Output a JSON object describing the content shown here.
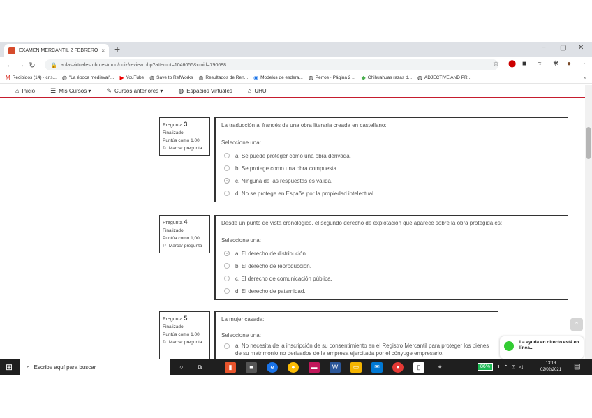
{
  "browser": {
    "tab_title": "EXAMEN MERCANTIL 2 FEBRERO",
    "tab_close": "×",
    "new_tab": "+",
    "window_controls": [
      "−",
      "▢",
      "✕"
    ],
    "url": "aulasvirtuales.uhu.es/mod/quiz/review.php?attempt=1046055&cmid=790688",
    "bookmarks": [
      {
        "icon": "gmail-icon",
        "label": "Recibidos (14) · cris..."
      },
      {
        "icon": "globe-icon",
        "label": "\"La época medieval\"..."
      },
      {
        "icon": "youtube-icon",
        "label": "YouTube"
      },
      {
        "icon": "globe-icon",
        "label": "Save to RefWorks"
      },
      {
        "icon": "globe-icon",
        "label": "Resultados de Ren..."
      },
      {
        "icon": "search-icon",
        "label": "Modelos de esdera..."
      },
      {
        "icon": "globe-icon",
        "label": "Perros · Página 2 ..."
      },
      {
        "icon": "game-icon",
        "label": "Chihuahuas razas d..."
      },
      {
        "icon": "globe-icon",
        "label": "ADJECTIVE AND PR..."
      }
    ],
    "bookmarks_more": "»"
  },
  "sitenav": {
    "items": [
      {
        "icon": "home-icon",
        "label": "Inicio"
      },
      {
        "icon": "courses-icon",
        "label": "Mis Cursos ▾"
      },
      {
        "icon": "graduation-cap-icon",
        "label": "Cursos anteriores ▾"
      },
      {
        "icon": "globe-icon",
        "label": "Espacios Virtuales"
      },
      {
        "icon": "bank-icon",
        "label": "UHU"
      }
    ]
  },
  "questions": [
    {
      "label": "Pregunta",
      "number": "3",
      "status": "Finalizado",
      "score": "Puntúa como 1,00",
      "flag": "Marcar pregunta",
      "text": "La traducción al francés de una obra literaria creada en castellano:",
      "select": "Seleccione una:",
      "options": [
        {
          "text": "a. Se puede proteger como una obra derivada.",
          "selected": false
        },
        {
          "text": "b. Se protege como una obra compuesta.",
          "selected": false
        },
        {
          "text": "c. Ninguna de las respuestas es válida.",
          "selected": true
        },
        {
          "text": "d. No se protege en España por la propiedad intelectual.",
          "selected": false
        }
      ]
    },
    {
      "label": "Pregunta",
      "number": "4",
      "status": "Finalizado",
      "score": "Puntúa como 1,00",
      "flag": "Marcar pregunta",
      "text": "Desde un punto de vista cronológico, el segundo derecho de explotación que aparece sobre la obra protegida es:",
      "select": "Seleccione una:",
      "options": [
        {
          "text": "a. El derecho de distribución.",
          "selected": true
        },
        {
          "text": "b. El derecho de reproducción.",
          "selected": false
        },
        {
          "text": "c. El derecho de comunicación pública.",
          "selected": false
        },
        {
          "text": "d. El derecho de paternidad.",
          "selected": false
        }
      ]
    },
    {
      "label": "Pregunta",
      "number": "5",
      "status": "Finalizado",
      "score": "Puntúa como 1,00",
      "flag": "Marcar pregunta",
      "text": "La mujer casada:",
      "select": "Seleccione una:",
      "options": [
        {
          "text": "a. No necesita de la inscripción de su consentimiento en el Registro Mercantil para proteger los bienes de su matrimonio no derivados de la empresa ejercitada por el cónyuge empresario.",
          "selected": false
        }
      ]
    }
  ],
  "help_bubble": "La ayuda en directo está en línea...",
  "taskbar": {
    "search_placeholder": "Escribe aquí para buscar",
    "battery": "86%",
    "time": "13:13",
    "date": "02/02/2021"
  }
}
